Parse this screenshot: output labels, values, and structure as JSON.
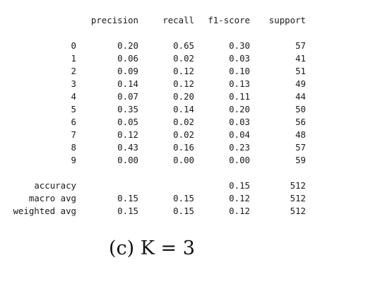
{
  "header": {
    "precision": "precision",
    "recall": "recall",
    "f1": "f1-score",
    "support": "support"
  },
  "rows": [
    {
      "label": "0",
      "precision": "0.20",
      "recall": "0.65",
      "f1": "0.30",
      "support": "57"
    },
    {
      "label": "1",
      "precision": "0.06",
      "recall": "0.02",
      "f1": "0.03",
      "support": "41"
    },
    {
      "label": "2",
      "precision": "0.09",
      "recall": "0.12",
      "f1": "0.10",
      "support": "51"
    },
    {
      "label": "3",
      "precision": "0.14",
      "recall": "0.12",
      "f1": "0.13",
      "support": "49"
    },
    {
      "label": "4",
      "precision": "0.07",
      "recall": "0.20",
      "f1": "0.11",
      "support": "44"
    },
    {
      "label": "5",
      "precision": "0.35",
      "recall": "0.14",
      "f1": "0.20",
      "support": "50"
    },
    {
      "label": "6",
      "precision": "0.05",
      "recall": "0.02",
      "f1": "0.03",
      "support": "56"
    },
    {
      "label": "7",
      "precision": "0.12",
      "recall": "0.02",
      "f1": "0.04",
      "support": "48"
    },
    {
      "label": "8",
      "precision": "0.43",
      "recall": "0.16",
      "f1": "0.23",
      "support": "57"
    },
    {
      "label": "9",
      "precision": "0.00",
      "recall": "0.00",
      "f1": "0.00",
      "support": "59"
    }
  ],
  "summary": [
    {
      "label": "accuracy",
      "precision": "",
      "recall": "",
      "f1": "0.15",
      "support": "512"
    },
    {
      "label": "macro avg",
      "precision": "0.15",
      "recall": "0.15",
      "f1": "0.12",
      "support": "512"
    },
    {
      "label": "weighted avg",
      "precision": "0.15",
      "recall": "0.15",
      "f1": "0.12",
      "support": "512"
    }
  ],
  "caption": "(c) K = 3"
}
